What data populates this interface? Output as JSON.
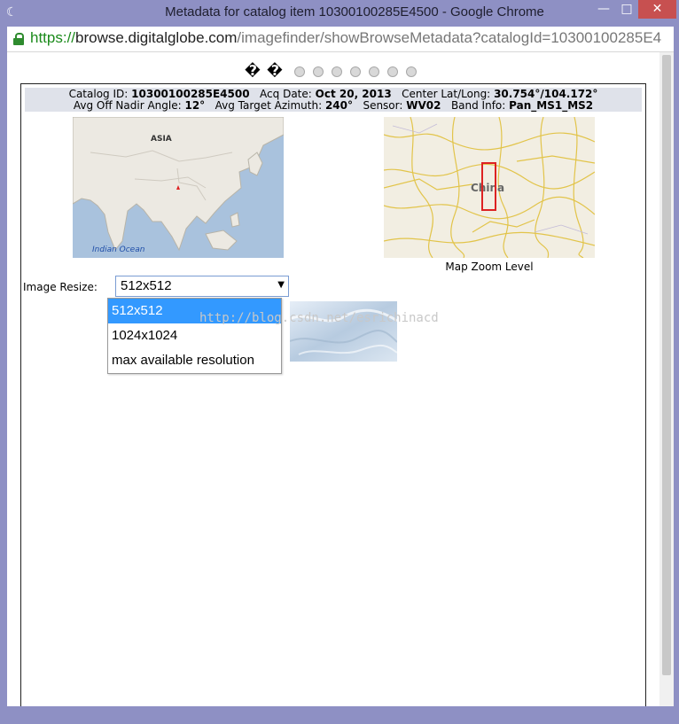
{
  "window": {
    "title": "Metadata for catalog item 10300100285E4500 - Google Chrome",
    "icon": "loading-moon-icon",
    "minimize_glyph": "—",
    "maximize_glyph": "□",
    "close_glyph": "✕"
  },
  "address": {
    "scheme": "https://",
    "host": "browse.digitalglobe.com",
    "path": "/imagefinder/showBrowseMetadata?catalogId=10300100285E4"
  },
  "pager": {
    "glyphs": [
      "�",
      "�"
    ],
    "dot_count": 7
  },
  "metadata": {
    "catalog_id_label": "Catalog ID:",
    "catalog_id": "10300100285E4500",
    "acq_date_label": "Acq Date:",
    "acq_date": "Oct 20, 2013",
    "center_label": "Center Lat/Long:",
    "center": "30.754°/104.172°",
    "off_nadir_label": "Avg Off Nadir Angle:",
    "off_nadir": "12°",
    "azimuth_label": "Avg Target Azimuth:",
    "azimuth": "240°",
    "sensor_label": "Sensor:",
    "sensor": "WV02",
    "band_label": "Band Info:",
    "band": "Pan_MS1_MS2"
  },
  "maps": {
    "overview_region_label": "ASIA",
    "overview_ocean_label": "Indian Ocean",
    "detail_country_label": "China",
    "zoom_label": "Map Zoom Level"
  },
  "resize": {
    "label": "Image Resize:",
    "selected": "512x512",
    "options": [
      "512x512",
      "1024x1024",
      "max available resolution"
    ]
  },
  "watermark": "http://blog.csdn.net/esrichinacd",
  "colors": {
    "frame": "#8e90c4",
    "close": "#c75050",
    "url_green": "#1a8a1a",
    "selection": "#3399ff",
    "meta_bg": "#dfe2ea",
    "footprint": "#dd2222"
  }
}
